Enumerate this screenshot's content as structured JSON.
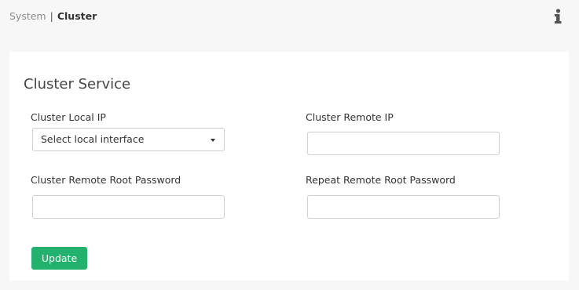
{
  "breadcrumb": {
    "parent": "System",
    "separator": "|",
    "current": "Cluster"
  },
  "header": {
    "info_icon": "info-icon"
  },
  "card": {
    "title": "Cluster Service",
    "fields": {
      "local_ip_label": "Cluster Local IP",
      "local_ip_select_value": "Select local interface",
      "remote_ip_label": "Cluster Remote IP",
      "remote_ip_value": "",
      "remote_password_label": "Cluster Remote Root Password",
      "remote_password_value": "",
      "repeat_password_label": "Repeat Remote Root Password",
      "repeat_password_value": ""
    },
    "update_label": "Update"
  },
  "colors": {
    "page_background": "#f7f7f7",
    "card_background": "#ffffff",
    "primary_button": "#23b26d",
    "input_border": "#cfcfcf"
  }
}
